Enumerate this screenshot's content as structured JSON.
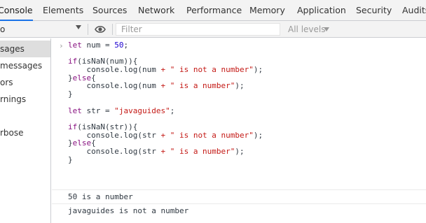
{
  "tabs": [
    {
      "label": "Console",
      "active": true
    },
    {
      "label": "Elements"
    },
    {
      "label": "Sources"
    },
    {
      "label": "Network"
    },
    {
      "label": "Performance"
    },
    {
      "label": "Memory"
    },
    {
      "label": "Application"
    },
    {
      "label": "Security"
    },
    {
      "label": "Audits"
    }
  ],
  "toolbar": {
    "context": "o",
    "filter_placeholder": "Filter",
    "levels": "All levels",
    "eye_icon": "eye-icon"
  },
  "sidebar": {
    "items": [
      {
        "label": "sages",
        "selected": true
      },
      {
        "label": "messages"
      },
      {
        "label": "ors"
      },
      {
        "label": "rnings"
      },
      {
        "label": ""
      },
      {
        "label": "rbose"
      }
    ]
  },
  "console": {
    "code": [
      "let num = 50;",
      "",
      "if(isNaN(num)){",
      "    console.log(num + \" is not a number\");",
      "}else{",
      "    console.log(num + \" is a number\");",
      "}",
      "",
      "let str = \"javaguides\";",
      "",
      "if(isNaN(str)){",
      "    console.log(str + \" is not a number\");",
      "}else{",
      "    console.log(str + \" is a number\");",
      "}"
    ],
    "outputs": [
      "50 is a number",
      "javaguides is not a number"
    ]
  },
  "colors": {
    "keyword": "#881280",
    "number": "#1c00cf",
    "string": "#c41a16",
    "active_tab_underline": "#1a73e8"
  }
}
